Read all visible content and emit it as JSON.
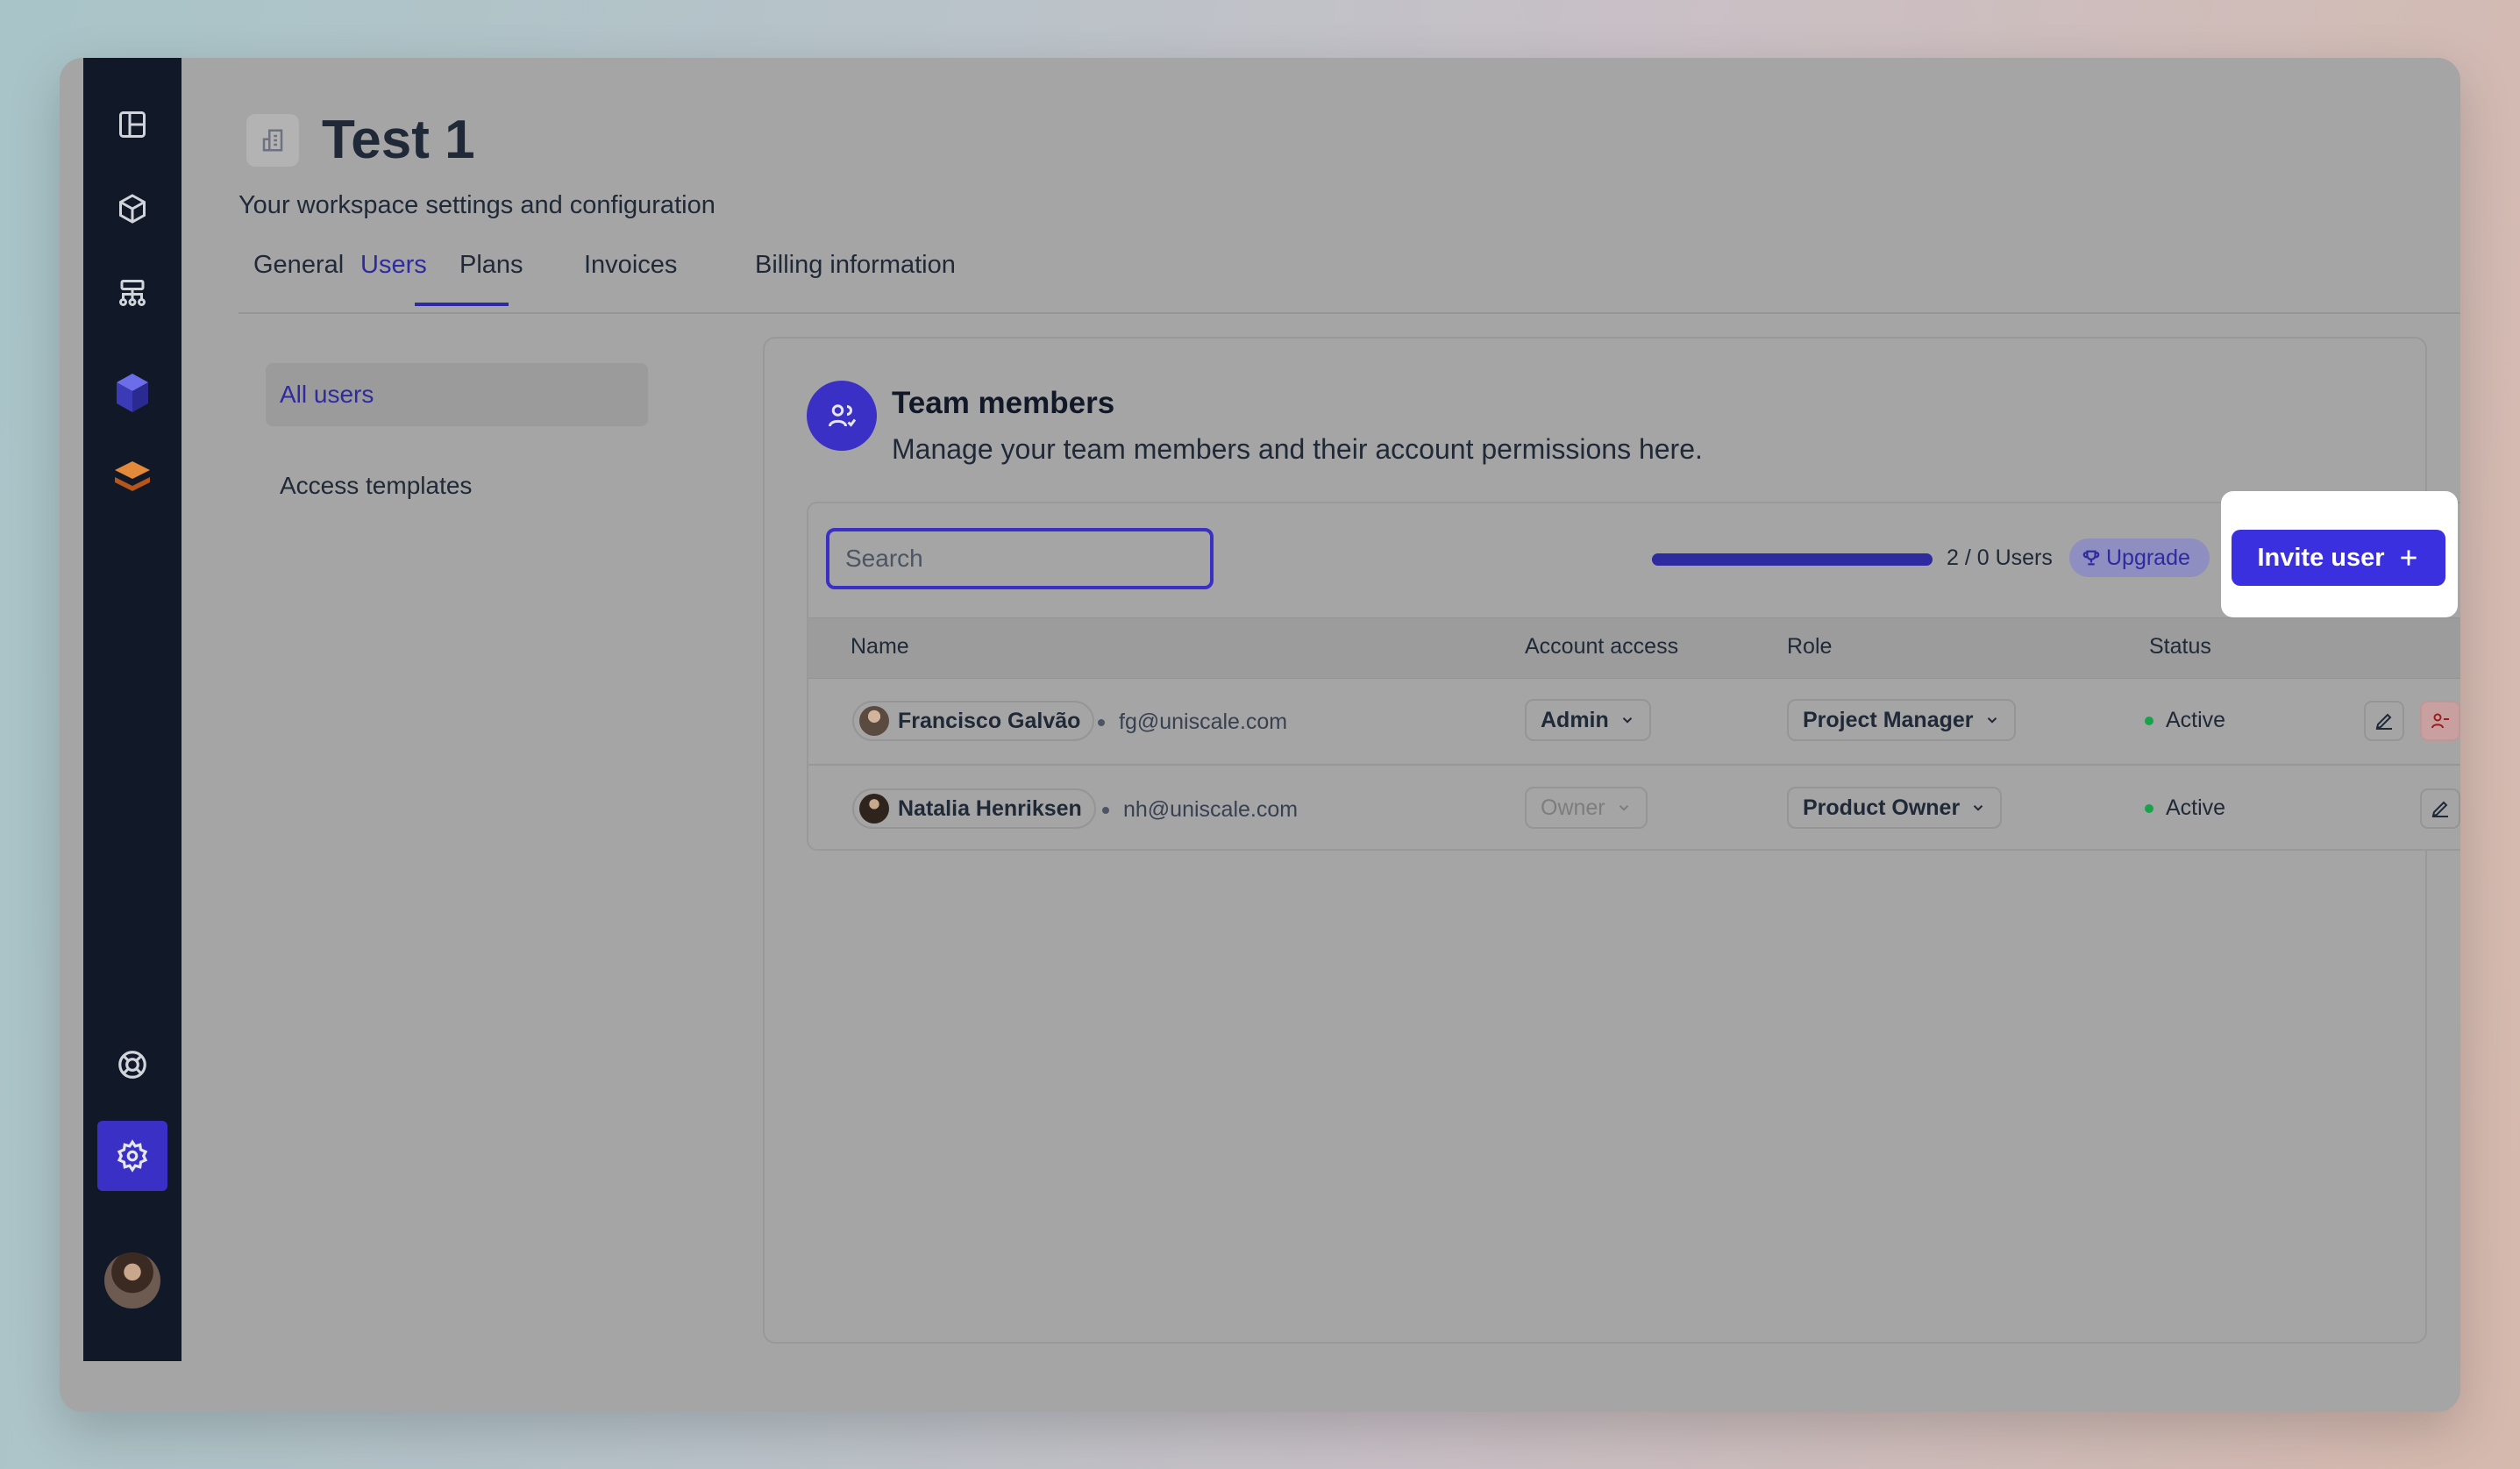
{
  "workspace": {
    "title": "Test 1",
    "subtitle": "Your workspace settings and configuration"
  },
  "tabs": [
    {
      "label": "General"
    },
    {
      "label": "Users",
      "active": true
    },
    {
      "label": "Plans"
    },
    {
      "label": "Invoices"
    },
    {
      "label": "Billing information"
    }
  ],
  "left_nav": {
    "all_users": "All users",
    "access_templates": "Access templates"
  },
  "team": {
    "title": "Team members",
    "description": "Manage your team members and their account permissions here."
  },
  "toolbar": {
    "search_placeholder": "Search",
    "usage_text": "2 / 0 Users",
    "usage_fraction": 1.0,
    "upgrade_label": "Upgrade",
    "invite_label": "Invite user"
  },
  "table": {
    "columns": [
      "Name",
      "Account access",
      "Role",
      "Status"
    ],
    "rows": [
      {
        "name": "Francisco Galvão",
        "email": "fg@uniscale.com",
        "access": "Admin",
        "role": "Project Manager",
        "status": "Active"
      },
      {
        "name": "Natalia Henriksen",
        "email": "nh@uniscale.com",
        "access": "Owner",
        "role": "Product Owner",
        "status": "Active"
      }
    ]
  },
  "colors": {
    "accent": "#3a30c5",
    "sidebar": "#111827",
    "status_active": "#16a34a"
  },
  "icons": {
    "sidebar": [
      "layout-icon",
      "cube-icon",
      "sitemap-icon",
      "logo-blue-icon",
      "logo-orange-icon",
      "help-icon",
      "settings-icon"
    ]
  }
}
